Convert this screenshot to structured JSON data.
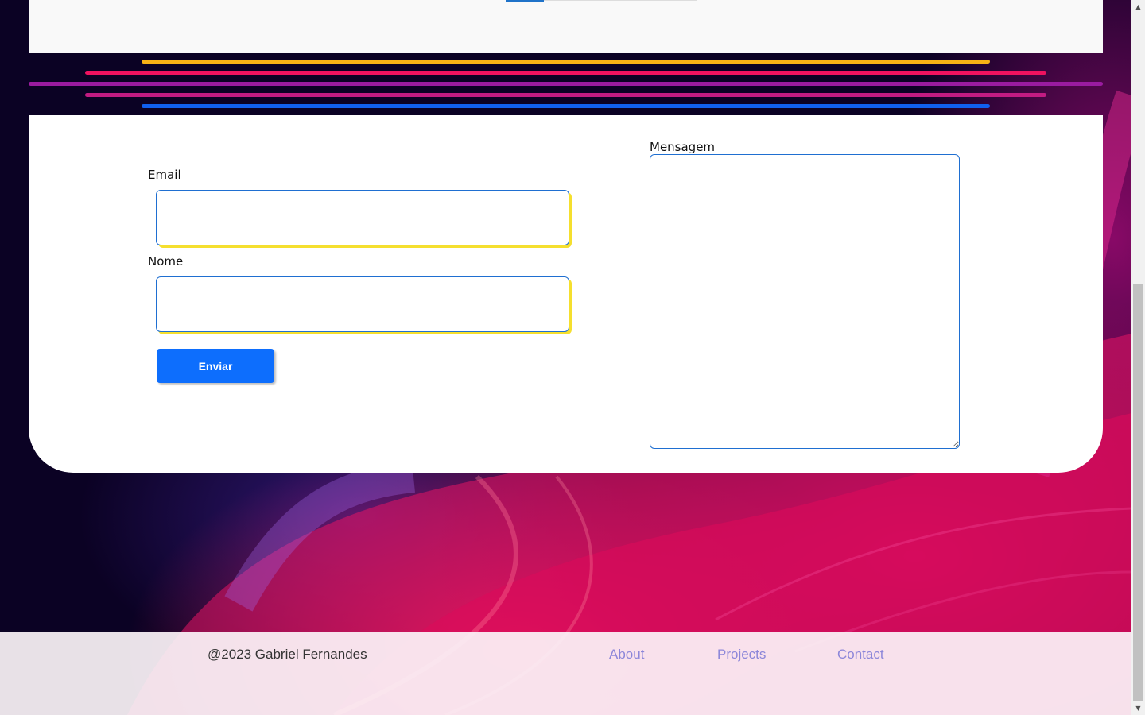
{
  "colors": {
    "accent": "#0d6efd",
    "stripe_yellow": "#f7b215",
    "stripe_pink": "#f0125f",
    "stripe_purple": "#9a1ba0",
    "stripe_magenta": "#c21b82",
    "stripe_blue": "#1060ee",
    "input_shadow": "#f5df2e",
    "footer_link": "#8c86d9"
  },
  "form": {
    "email_label": "Email",
    "email_value": "",
    "name_label": "Nome",
    "name_value": "",
    "message_label": "Mensagem",
    "message_value": "",
    "submit_label": "Enviar"
  },
  "footer": {
    "copyright": "@2023 Gabriel Fernandes",
    "links": [
      {
        "label": "About"
      },
      {
        "label": "Projects"
      },
      {
        "label": "Contact"
      }
    ]
  },
  "scrollbar": {
    "up_icon": "triangle-up",
    "down_icon": "triangle-down"
  }
}
